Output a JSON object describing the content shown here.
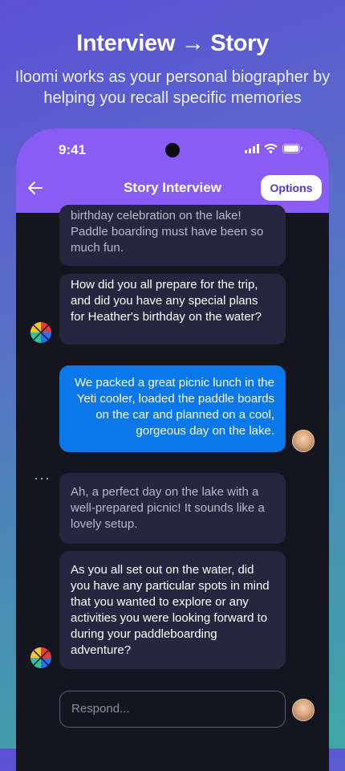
{
  "promo": {
    "title": "Interview → Story",
    "subtitle": "Iloomi works as your personal biographer by helping you recall specific memories"
  },
  "status_bar": {
    "time": "9:41"
  },
  "header": {
    "title": "Story Interview",
    "options_label": "Options",
    "back_icon": "arrow-left-icon"
  },
  "messages": [
    {
      "sender": "bot",
      "text": "birthday celebration on the lake! Paddle boarding must have been so much fun."
    },
    {
      "sender": "bot",
      "text": "How did you all prepare for the trip, and did you have any special plans for Heather's birthday on the water?"
    },
    {
      "sender": "user",
      "text": "We packed a great picnic lunch in the Yeti cooler, loaded the paddle boards on the car and planned on a cool, gorgeous day on the lake."
    },
    {
      "sender": "bot",
      "text": "Ah, a perfect day on the lake with a well-prepared picnic! It sounds like a lovely setup."
    },
    {
      "sender": "bot",
      "text": "As you all set out on the water, did you have any particular spots in mind that you wanted to explore or any activities you were looking forward to during your paddleboarding adventure?"
    }
  ],
  "typing_indicator": "···",
  "composer": {
    "placeholder": "Respond..."
  },
  "colors": {
    "header": "#8a5cf6",
    "user_bubble": "#0a78e8",
    "bot_bubble": "#262640",
    "chat_background": "#15151f"
  }
}
